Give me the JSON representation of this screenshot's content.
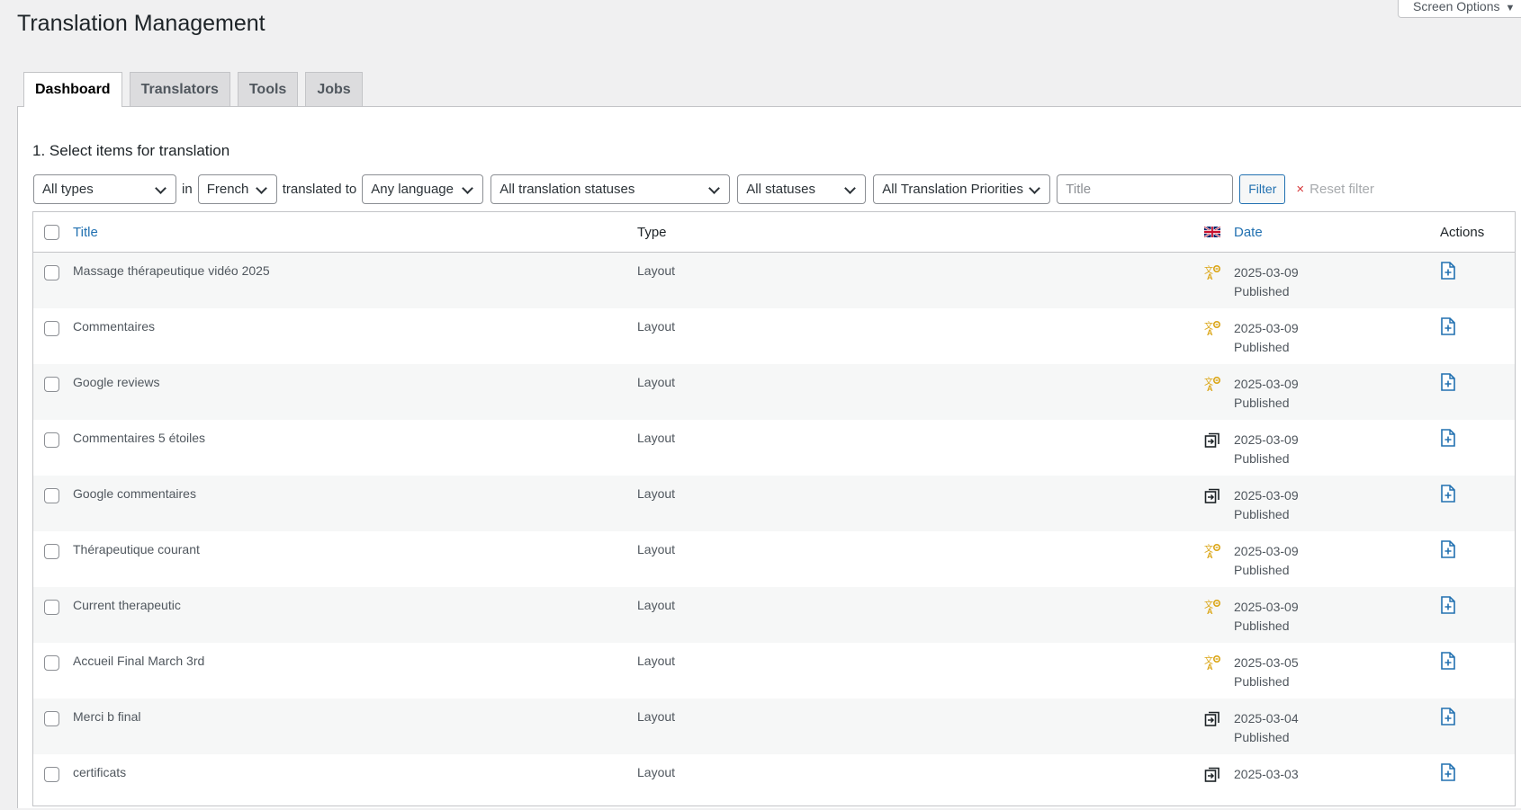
{
  "page_title": "Translation Management",
  "screen_options": {
    "label": "Screen Options",
    "arrow": "▼"
  },
  "tabs": [
    {
      "label": "Dashboard",
      "active": true
    },
    {
      "label": "Translators",
      "active": false
    },
    {
      "label": "Tools",
      "active": false
    },
    {
      "label": "Jobs",
      "active": false
    }
  ],
  "section_title": "1. Select items for translation",
  "filters": {
    "type": "All types",
    "in_label": "in",
    "source_language": "French",
    "translated_to_label": "translated to",
    "target_language": "Any language",
    "translation_status": "All translation statuses",
    "status": "All statuses",
    "priority": "All Translation Priorities",
    "title_placeholder": "Title",
    "filter_button": "Filter",
    "reset_icon": "×",
    "reset_label": "Reset filter"
  },
  "table": {
    "headers": {
      "title": "Title",
      "type": "Type",
      "date": "Date",
      "actions": "Actions",
      "flag_icon": "uk-flag-icon"
    },
    "rows": [
      {
        "title": "Massage thérapeutique vidéo 2025",
        "type": "Layout",
        "status_icon": "needs-translation-icon",
        "date": "2025-03-09",
        "status": "Published"
      },
      {
        "title": "Commentaires",
        "type": "Layout",
        "status_icon": "needs-translation-icon",
        "date": "2025-03-09",
        "status": "Published"
      },
      {
        "title": "Google reviews",
        "type": "Layout",
        "status_icon": "needs-translation-icon",
        "date": "2025-03-09",
        "status": "Published"
      },
      {
        "title": "Commentaires 5 étoiles",
        "type": "Layout",
        "status_icon": "duplicate-icon",
        "date": "2025-03-09",
        "status": "Published"
      },
      {
        "title": "Google commentaires",
        "type": "Layout",
        "status_icon": "duplicate-icon",
        "date": "2025-03-09",
        "status": "Published"
      },
      {
        "title": "Thérapeutique courant",
        "type": "Layout",
        "status_icon": "needs-translation-icon",
        "date": "2025-03-09",
        "status": "Published"
      },
      {
        "title": "Current therapeutic",
        "type": "Layout",
        "status_icon": "needs-translation-icon",
        "date": "2025-03-09",
        "status": "Published"
      },
      {
        "title": "Accueil Final March 3rd",
        "type": "Layout",
        "status_icon": "needs-translation-icon",
        "date": "2025-03-05",
        "status": "Published"
      },
      {
        "title": "Merci b final",
        "type": "Layout",
        "status_icon": "duplicate-icon",
        "date": "2025-03-04",
        "status": "Published"
      },
      {
        "title": "certificats",
        "type": "Layout",
        "status_icon": "duplicate-icon",
        "date": "2025-03-03",
        "status": ""
      }
    ]
  },
  "colors": {
    "link": "#2271b1",
    "needs_translation": "#dba617",
    "danger": "#d63638"
  }
}
